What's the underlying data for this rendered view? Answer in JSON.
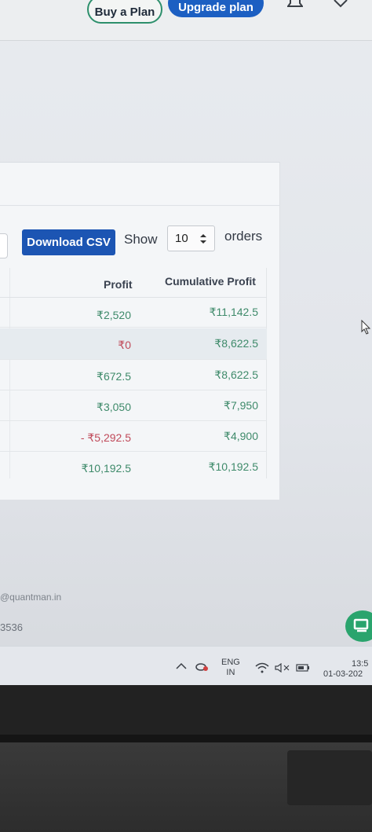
{
  "header": {
    "buy_plan_label": "Buy a Plan",
    "upgrade_label": "Upgrade plan"
  },
  "controls": {
    "download_label": "Download CSV",
    "show_label": "Show",
    "page_size_value": "10",
    "orders_label": "orders"
  },
  "table": {
    "columns": [
      "Profit",
      "Cumulative Profit"
    ],
    "rows": [
      {
        "profit": "₹2,520",
        "cumulative": "₹11,142.5",
        "profit_status": "positive"
      },
      {
        "profit": "₹0",
        "cumulative": "₹8,622.5",
        "profit_status": "zero"
      },
      {
        "profit": "₹672.5",
        "cumulative": "₹8,622.5",
        "profit_status": "positive"
      },
      {
        "profit": "₹3,050",
        "cumulative": "₹7,950",
        "profit_status": "positive"
      },
      {
        "profit": "- ₹5,292.5",
        "cumulative": "₹4,900",
        "profit_status": "negative"
      },
      {
        "profit": "₹10,192.5",
        "cumulative": "₹10,192.5",
        "profit_status": "positive"
      }
    ]
  },
  "footer": {
    "email": "@quantman.in",
    "number": "3536"
  },
  "taskbar": {
    "lang_line1": "ENG",
    "lang_line2": "IN",
    "time": "13:5",
    "date": "01-03-202"
  },
  "colors": {
    "positive": "#3e8a6a",
    "negative": "#c04a5a",
    "accent": "#1c55b3"
  }
}
